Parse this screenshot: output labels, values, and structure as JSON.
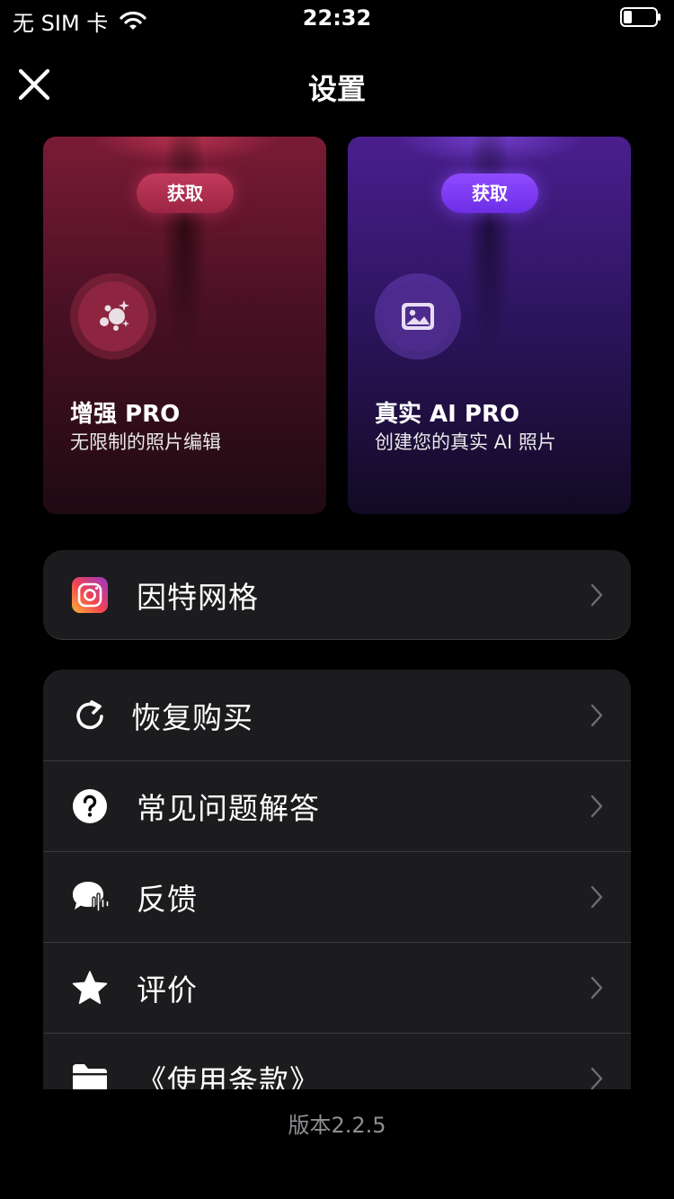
{
  "status_bar": {
    "carrier": "无 SIM 卡",
    "time": "22:32"
  },
  "header": {
    "title": "设置"
  },
  "promos": [
    {
      "button": "获取",
      "title": "增强 PRO",
      "desc": "无限制的照片编辑",
      "icon": "sparkle-bubbles-icon",
      "accent": "#c23a5c"
    },
    {
      "button": "获取",
      "title": "真实 AI PRO",
      "desc": "创建您的真实 AI 照片",
      "icon": "image-icon",
      "accent": "#8f4bff"
    }
  ],
  "social": {
    "label": "因特网格",
    "icon": "instagram-icon"
  },
  "menu": [
    {
      "label": "恢复购买",
      "icon": "restore-icon"
    },
    {
      "label": "常见问题解答",
      "icon": "question-icon"
    },
    {
      "label": "反馈",
      "icon": "feedback-icon"
    },
    {
      "label": "评价",
      "icon": "star-icon"
    },
    {
      "label": "《使用条款》",
      "icon": "folder-icon"
    }
  ],
  "footer": {
    "version": "版本2.2.5"
  }
}
